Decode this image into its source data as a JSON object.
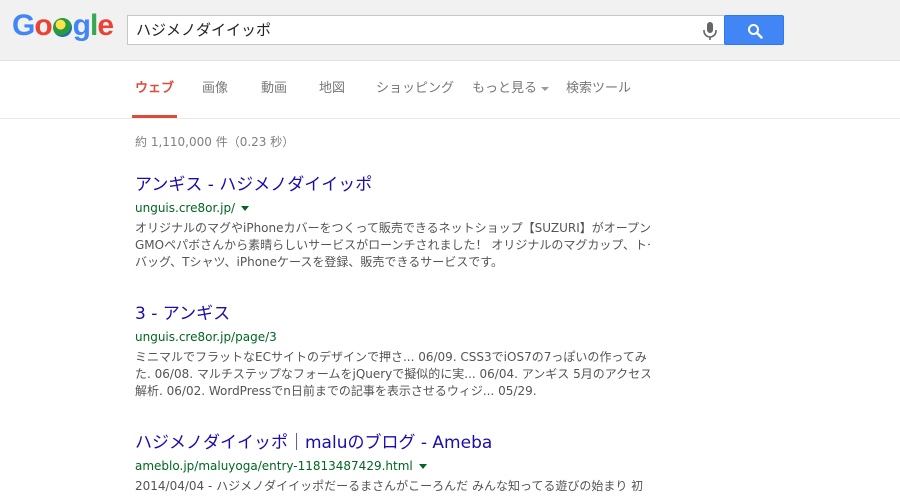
{
  "logo": {
    "letters": [
      "G",
      "o",
      "",
      "g",
      "l",
      "e"
    ],
    "colors": [
      "#4285f4",
      "#ea4335",
      "",
      "#4285f4",
      "#34a853",
      "#ea4335"
    ]
  },
  "search": {
    "value": "ハジメノダイイッポ"
  },
  "nav": {
    "tabs": [
      {
        "label": "ウェブ",
        "active": true
      },
      {
        "label": "画像"
      },
      {
        "label": "動画"
      },
      {
        "label": "地図"
      },
      {
        "label": "ショッピング"
      },
      {
        "label": "もっと見る"
      },
      {
        "label": "検索ツール"
      }
    ]
  },
  "stats": "約 1,110,000 件（0.23 秒）",
  "results": [
    {
      "title": "アンギス - ハジメノダイイッポ",
      "url": "unguis.cre8or.jp/",
      "snippet": [
        "オリジナルのマグやiPhoneカバーをつくって販売できるネットショップ【SUZURI】がオープン！",
        "GMOペパボさんから素晴らしいサービスがローンチされました！ オリジナルのマグカップ、トート",
        "バッグ、Tシャツ、iPhoneケースを登録、販売できるサービスです。"
      ]
    },
    {
      "title": "3 - アンギス",
      "url": "unguis.cre8or.jp/page/3",
      "snippet": [
        "ミニマルでフラットなECサイトのデザインで押さ... 06/09. CSS3でiOS7の7っぽいの作ってみ",
        "た. 06/08. マルチステップなフォームをjQueryで擬似的に実... 06/04. アンギス 5月のアクセス",
        "解析. 06/02. WordPressでn日前までの記事を表示させるウィジ... 05/29."
      ]
    },
    {
      "title": "ハジメノダイイッポ｜maluのブログ - Ameba",
      "url": "ameblo.jp/maluyoga/entry-11813487429.html",
      "snippet": [
        "2014/04/04 - ハジメノダイイッポだーるまさんがこーろんだ みんな知ってる遊びの始まり 初"
      ]
    }
  ]
}
